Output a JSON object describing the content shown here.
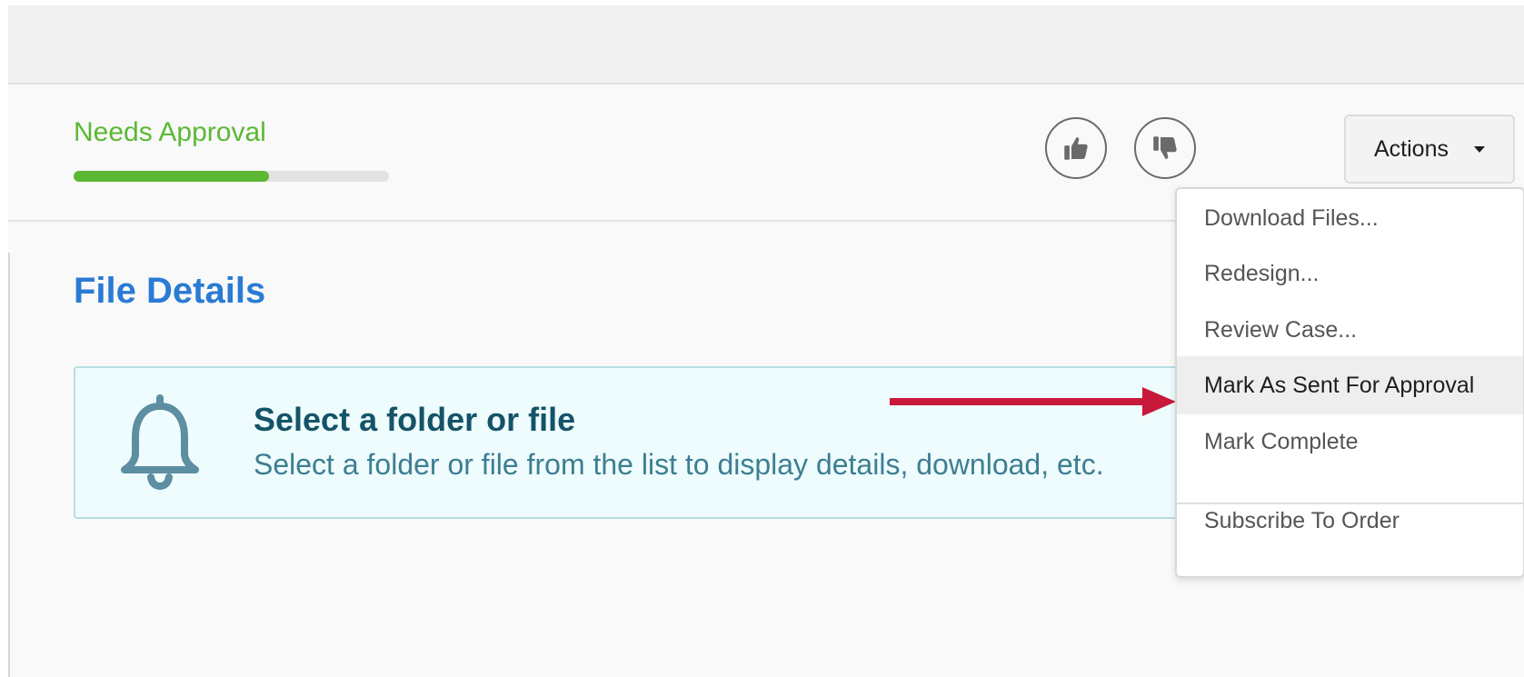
{
  "status": {
    "label": "Needs Approval",
    "progress_fraction": 0.62,
    "color": "#5cb833"
  },
  "vote": {
    "approve_icon": "thumbs-up-icon",
    "reject_icon": "thumbs-down-icon"
  },
  "actions": {
    "label": "Actions",
    "menu_items": [
      "Download Files...",
      "Redesign...",
      "Review Case...",
      "Mark As Sent For Approval",
      "Mark Complete",
      "Subscribe To Order"
    ],
    "highlighted_item": "Mark As Sent For Approval"
  },
  "main": {
    "title": "File Details",
    "notice": {
      "icon": "bell-icon",
      "title": "Select a folder or file",
      "body": "Select a folder or file from the list to display details, download, etc."
    }
  },
  "colors": {
    "accent_blue": "#2a7bd4",
    "arrow": "#c8193b",
    "notice_bg": "#eefcfd"
  }
}
